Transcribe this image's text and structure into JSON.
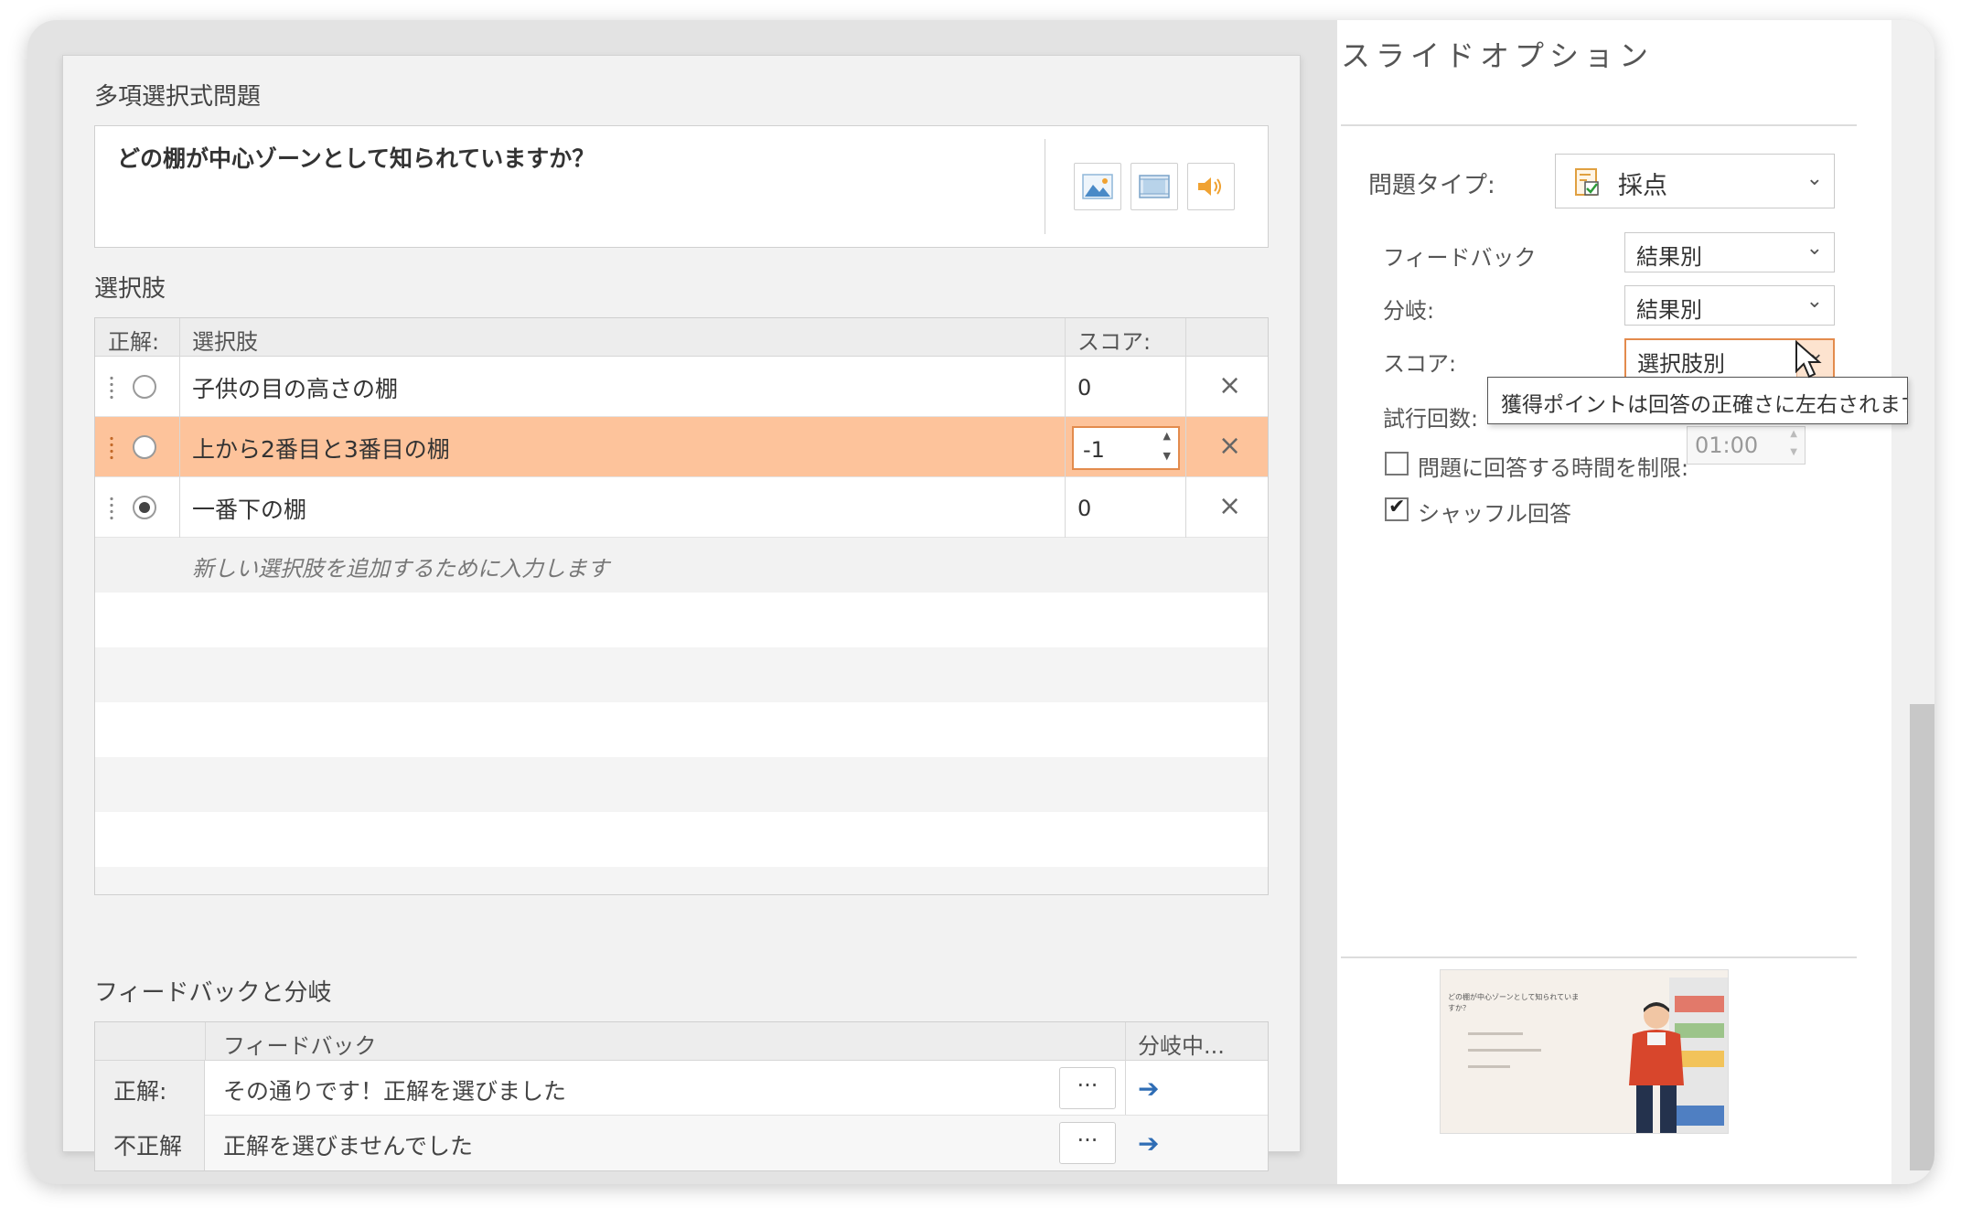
{
  "editor": {
    "question_section": "多項選択式問題",
    "question_text": "どの棚が中心ゾーンとして知られていますか？",
    "media_icons": [
      "image-icon",
      "video-icon",
      "audio-icon"
    ],
    "choices_section": "選択肢",
    "choices_header": {
      "correct": "正解:",
      "choice": "選択肢",
      "score": "スコア:"
    },
    "choices": [
      {
        "text": "子供の目の高さの棚",
        "score": "0",
        "correct": false,
        "selected": false
      },
      {
        "text": "上から2番目と3番目の棚",
        "score": "-1",
        "correct": false,
        "selected": true
      },
      {
        "text": "一番下の棚",
        "score": "0",
        "correct": true,
        "selected": false
      }
    ],
    "new_choice_placeholder": "新しい選択肢を追加するために入力します",
    "feedback_section": "フィードバックと分岐",
    "feedback_header": {
      "feedback": "フィードバック",
      "branch": "分岐中..."
    },
    "feedback_rows": [
      {
        "label": "正解:",
        "text": "その通りです！正解を選びました",
        "more": "···",
        "branch_icon": "arrow-right-icon"
      },
      {
        "label": "不正解",
        "text": "正解を選びませんでした",
        "more": "···",
        "branch_icon": "arrow-right-icon"
      }
    ]
  },
  "options": {
    "title": "スライドオプション",
    "question_type_label": "問題タイプ:",
    "question_type_value": "採点",
    "feedback_label": "フィードバック",
    "feedback_value": "結果別",
    "branch_label": "分岐:",
    "branch_value": "結果別",
    "score_label": "スコア:",
    "score_value": "選択肢別",
    "attempts_label": "試行回数:",
    "tooltip": "獲得ポイントは回答の正確さに左右されます。",
    "time_limit_label": "問題に回答する時間を制限:",
    "time_limit_value": "01:00",
    "time_limit_checked": false,
    "shuffle_label": "シャッフル回答",
    "shuffle_checked": true
  },
  "thumbnail": {
    "title": "どの棚が中心ゾーンとして知られていますか？"
  },
  "colors": {
    "selected_row": "#fdc39b",
    "accent_orange": "#e38b4d",
    "branch_arrow": "#2f6db5"
  }
}
